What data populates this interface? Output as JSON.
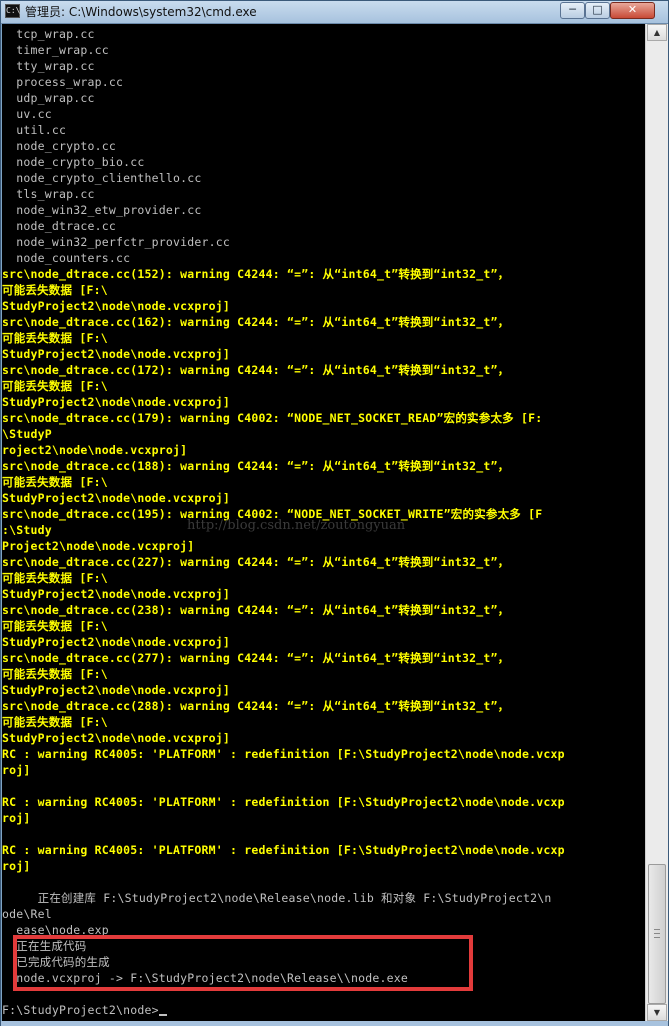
{
  "window": {
    "title": "管理员: C:\\Windows\\system32\\cmd.exe",
    "app_icon_text": "C:\\",
    "minimize_glyph": "─",
    "maximize_glyph": "□",
    "close_glyph": "✕"
  },
  "console": {
    "lines": [
      {
        "text": "  tcp_wrap.cc",
        "color": "white"
      },
      {
        "text": "  timer_wrap.cc",
        "color": "white"
      },
      {
        "text": "  tty_wrap.cc",
        "color": "white"
      },
      {
        "text": "  process_wrap.cc",
        "color": "white"
      },
      {
        "text": "  udp_wrap.cc",
        "color": "white"
      },
      {
        "text": "  uv.cc",
        "color": "white"
      },
      {
        "text": "  util.cc",
        "color": "white"
      },
      {
        "text": "  node_crypto.cc",
        "color": "white"
      },
      {
        "text": "  node_crypto_bio.cc",
        "color": "white"
      },
      {
        "text": "  node_crypto_clienthello.cc",
        "color": "white"
      },
      {
        "text": "  tls_wrap.cc",
        "color": "white"
      },
      {
        "text": "  node_win32_etw_provider.cc",
        "color": "white"
      },
      {
        "text": "  node_dtrace.cc",
        "color": "white"
      },
      {
        "text": "  node_win32_perfctr_provider.cc",
        "color": "white"
      },
      {
        "text": "  node_counters.cc",
        "color": "white"
      },
      {
        "text": "src\\node_dtrace.cc(152): warning C4244: “=”: 从“int64_t”转换到“int32_t”，",
        "color": "yellow"
      },
      {
        "text": "可能丢失数据 [F:\\",
        "color": "yellow"
      },
      {
        "text": "StudyProject2\\node\\node.vcxproj]",
        "color": "yellow"
      },
      {
        "text": "src\\node_dtrace.cc(162): warning C4244: “=”: 从“int64_t”转换到“int32_t”，",
        "color": "yellow"
      },
      {
        "text": "可能丢失数据 [F:\\",
        "color": "yellow"
      },
      {
        "text": "StudyProject2\\node\\node.vcxproj]",
        "color": "yellow"
      },
      {
        "text": "src\\node_dtrace.cc(172): warning C4244: “=”: 从“int64_t”转换到“int32_t”，",
        "color": "yellow"
      },
      {
        "text": "可能丢失数据 [F:\\",
        "color": "yellow"
      },
      {
        "text": "StudyProject2\\node\\node.vcxproj]",
        "color": "yellow"
      },
      {
        "text": "src\\node_dtrace.cc(179): warning C4002: “NODE_NET_SOCKET_READ”宏的实参太多 [F:",
        "color": "yellow"
      },
      {
        "text": "\\StudyP",
        "color": "yellow"
      },
      {
        "text": "roject2\\node\\node.vcxproj]",
        "color": "yellow"
      },
      {
        "text": "src\\node_dtrace.cc(188): warning C4244: “=”: 从“int64_t”转换到“int32_t”，",
        "color": "yellow"
      },
      {
        "text": "可能丢失数据 [F:\\",
        "color": "yellow"
      },
      {
        "text": "StudyProject2\\node\\node.vcxproj]",
        "color": "yellow"
      },
      {
        "text": "src\\node_dtrace.cc(195): warning C4002: “NODE_NET_SOCKET_WRITE”宏的实参太多 [F",
        "color": "yellow"
      },
      {
        "text": ":\\Study",
        "color": "yellow"
      },
      {
        "text": "Project2\\node\\node.vcxproj]",
        "color": "yellow"
      },
      {
        "text": "src\\node_dtrace.cc(227): warning C4244: “=”: 从“int64_t”转换到“int32_t”，",
        "color": "yellow"
      },
      {
        "text": "可能丢失数据 [F:\\",
        "color": "yellow"
      },
      {
        "text": "StudyProject2\\node\\node.vcxproj]",
        "color": "yellow"
      },
      {
        "text": "src\\node_dtrace.cc(238): warning C4244: “=”: 从“int64_t”转换到“int32_t”，",
        "color": "yellow"
      },
      {
        "text": "可能丢失数据 [F:\\",
        "color": "yellow"
      },
      {
        "text": "StudyProject2\\node\\node.vcxproj]",
        "color": "yellow"
      },
      {
        "text": "src\\node_dtrace.cc(277): warning C4244: “=”: 从“int64_t”转换到“int32_t”，",
        "color": "yellow"
      },
      {
        "text": "可能丢失数据 [F:\\",
        "color": "yellow"
      },
      {
        "text": "StudyProject2\\node\\node.vcxproj]",
        "color": "yellow"
      },
      {
        "text": "src\\node_dtrace.cc(288): warning C4244: “=”: 从“int64_t”转换到“int32_t”，",
        "color": "yellow"
      },
      {
        "text": "可能丢失数据 [F:\\",
        "color": "yellow"
      },
      {
        "text": "StudyProject2\\node\\node.vcxproj]",
        "color": "yellow"
      },
      {
        "text": "RC : warning RC4005: 'PLATFORM' : redefinition [F:\\StudyProject2\\node\\node.vcxp",
        "color": "yellow"
      },
      {
        "text": "roj]",
        "color": "yellow"
      },
      {
        "text": "",
        "color": "yellow"
      },
      {
        "text": "RC : warning RC4005: 'PLATFORM' : redefinition [F:\\StudyProject2\\node\\node.vcxp",
        "color": "yellow"
      },
      {
        "text": "roj]",
        "color": "yellow"
      },
      {
        "text": "",
        "color": "yellow"
      },
      {
        "text": "RC : warning RC4005: 'PLATFORM' : redefinition [F:\\StudyProject2\\node\\node.vcxp",
        "color": "yellow"
      },
      {
        "text": "roj]",
        "color": "yellow"
      },
      {
        "text": "",
        "color": "white"
      },
      {
        "text": "     正在创建库 F:\\StudyProject2\\node\\Release\\node.lib 和对象 F:\\StudyProject2\\n",
        "color": "white"
      },
      {
        "text": "ode\\Rel",
        "color": "white"
      },
      {
        "text": "  ease\\node.exp",
        "color": "white"
      },
      {
        "text": "  正在生成代码",
        "color": "white"
      },
      {
        "text": "  已完成代码的生成",
        "color": "white"
      },
      {
        "text": "  node.vcxproj -> F:\\StudyProject2\\node\\Release\\\\node.exe",
        "color": "white"
      },
      {
        "text": "",
        "color": "white"
      },
      {
        "text": "F:\\StudyProject2\\node>",
        "color": "white"
      }
    ]
  },
  "watermark": "http://blog.csdn.net/zoutongyuan",
  "scrollbar": {
    "up_glyph": "▲",
    "down_glyph": "▼",
    "position_fraction": 1.0
  }
}
